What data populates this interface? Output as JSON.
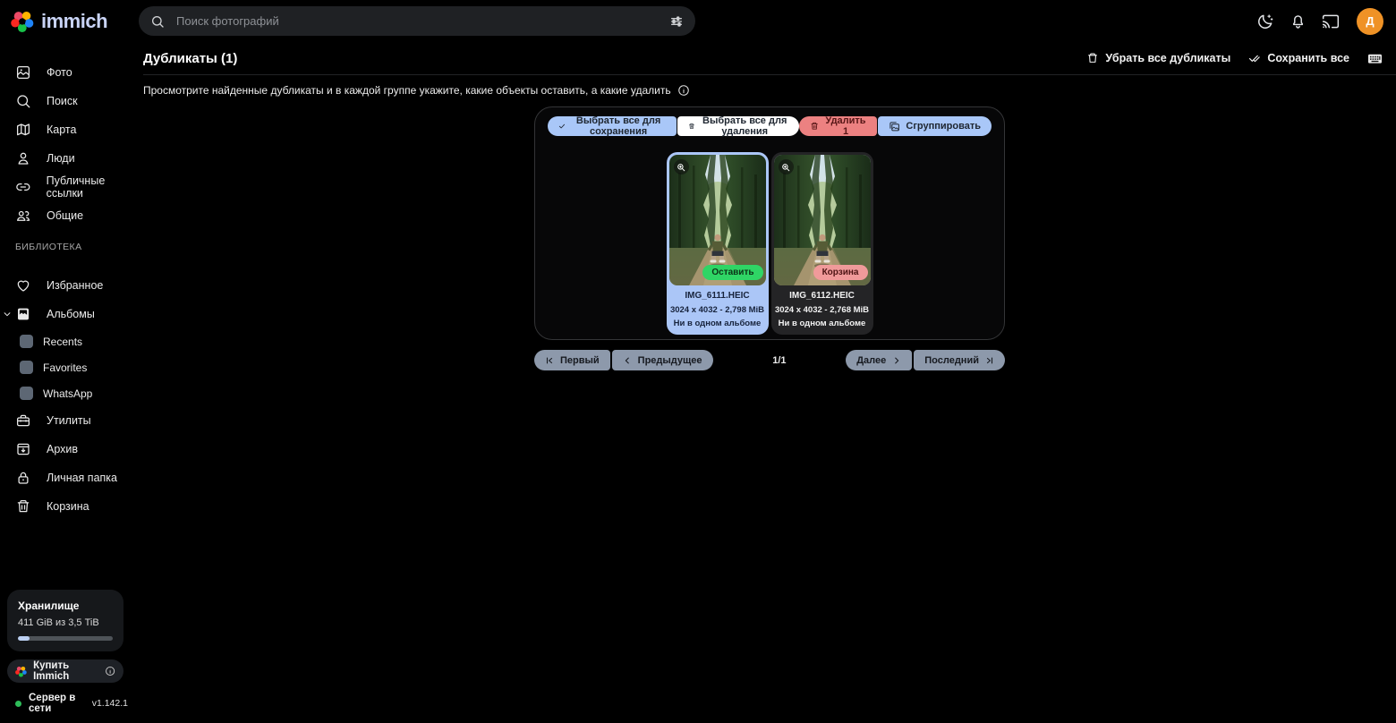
{
  "topbar": {
    "logo_text": "immich",
    "search_placeholder": "Поиск фотографий",
    "avatar_letter": "Д"
  },
  "sidebar": {
    "items": [
      {
        "label": "Фото"
      },
      {
        "label": "Поиск"
      },
      {
        "label": "Карта"
      },
      {
        "label": "Люди"
      },
      {
        "label": "Публичные ссылки"
      },
      {
        "label": "Общие"
      }
    ],
    "section_label": "БИБЛИОТЕКА",
    "favorites_label": "Избранное",
    "albums_label": "Альбомы",
    "albums": [
      {
        "label": "Recents"
      },
      {
        "label": "Favorites"
      },
      {
        "label": "WhatsApp"
      }
    ],
    "utilities_label": "Утилиты",
    "archive_label": "Архив",
    "locked_folder_label": "Личная папка",
    "trash_label": "Корзина",
    "storage": {
      "title": "Хранилище",
      "usage": "411 GiB из 3,5 TiB",
      "percent_used": 12
    },
    "buy_label": "Купить Immich",
    "server_status": "Сервер в сети",
    "version": "v1.142.1"
  },
  "header": {
    "title": "Дубликаты (1)",
    "deduplicate_all_label": "Убрать все дубликаты",
    "keep_all_label": "Сохранить все",
    "description": "Просмотрите найденные дубликаты и в каждой группе укажите, какие объекты оставить, а какие удалить"
  },
  "group": {
    "select_keep_label": "Выбрать все для сохранения",
    "select_trash_label": "Выбрать все для удаления",
    "delete_label": "Удалить 1",
    "stack_label": "Сгруппировать",
    "assets": [
      {
        "filename": "IMG_6111.HEIC",
        "meta": "3024 x 4032 - 2,798 MiB",
        "album": "Ни в одном альбоме",
        "badge": "Оставить"
      },
      {
        "filename": "IMG_6112.HEIC",
        "meta": "3024 x 4032 - 2,768 MiB",
        "album": "Ни в одном альбоме",
        "badge": "Корзина"
      }
    ]
  },
  "pagination": {
    "first_label": "Первый",
    "prev_label": "Предыдущее",
    "page_indicator": "1/1",
    "next_label": "Далее",
    "last_label": "Последний"
  },
  "colors": {
    "accent_blue": "#a9c7f8",
    "danger_coral": "#ec8181",
    "keep_green": "#2fd565",
    "trash_pink": "#f09a9a",
    "avatar_orange": "#ef9226",
    "online_green": "#2ebd59"
  }
}
